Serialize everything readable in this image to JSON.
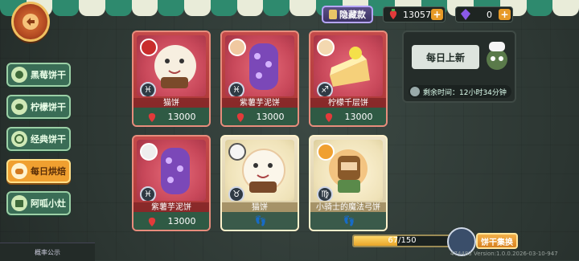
{
  "colors": {
    "accent": "#e79a27",
    "card_red": "#b63c3c",
    "card_cream": "#e6dab6",
    "side_active": "#f0a030",
    "side_idle": "#3a6d56"
  },
  "sidebar": {
    "items": [
      {
        "label": "黑莓饼干",
        "icon": "blackberry-icon",
        "active": false
      },
      {
        "label": "柠檬饼干",
        "icon": "lemon-icon",
        "active": false
      },
      {
        "label": "经典饼干",
        "icon": "cookie-icon",
        "active": false
      },
      {
        "label": "每日烘焙",
        "icon": "bread-icon",
        "active": true
      },
      {
        "label": "阿呱小灶",
        "icon": "stove-icon",
        "active": false
      }
    ]
  },
  "bottom_tab": {
    "label": "概率公示"
  },
  "top": {
    "hidden_label": "隐藏款",
    "strawberry": "13057",
    "crystal": "0"
  },
  "cards": [
    {
      "name": "猫饼",
      "price": "13000",
      "sign": "♓",
      "style": "red"
    },
    {
      "name": "紫薯芋泥饼",
      "price": "13000",
      "sign": "♓",
      "style": "red"
    },
    {
      "name": "柠檬千层饼",
      "price": "13000",
      "sign": "♐",
      "style": "red"
    },
    {
      "name": "紫薯芋泥饼",
      "price": "13000",
      "sign": "♓",
      "style": "red"
    },
    {
      "name": "猫饼",
      "price": "",
      "sign": "♉",
      "style": "cream"
    },
    {
      "name": "小骑士的魔法弓饼",
      "price": "",
      "sign": "♍",
      "style": "cream"
    }
  ],
  "info": {
    "banner": "每日上新",
    "timer": "剩余时间：12小时34分钟"
  },
  "collection": {
    "progress": "67/150",
    "progress_fraction": 0.447,
    "button": "饼干集换"
  },
  "version": "474483 Version:1.0.0.2026-03-10-947"
}
